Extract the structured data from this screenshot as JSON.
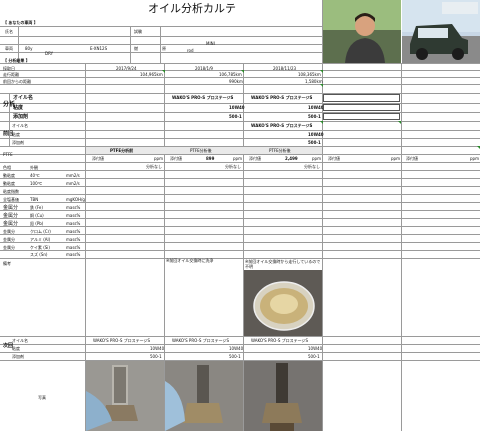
{
  "header": {
    "title": "オイル分析カルテ",
    "section_top": "【 あなたの車両 】",
    "name_label": "氏名",
    "name_value": "",
    "test_label": "試験",
    "vehicle_label": "車両",
    "vehicle_year": "80y",
    "vehicle_engine": "DRY",
    "vehicle_model": "E-XN12S",
    "vehicle_fuel_label": "燃",
    "vehicle_fuel": "原",
    "vehicle_extra": "rod",
    "vehicle_code": "MINI"
  },
  "section_results": "【 分析結果 】",
  "dates": [
    "2017/9/24",
    "2018/1/9",
    "2018/11/23"
  ],
  "rows": {
    "sample_date": "採取日",
    "mileage": "走行距離",
    "mileage_values": [
      "104,965km",
      "106,785km",
      "108,365km"
    ],
    "oil_change_distance": "前回からの距離",
    "oil_change_values": [
      "",
      "990km",
      "1,580km"
    ],
    "oil_name_label": "オイル名",
    "oil_grade_label": "粘度",
    "oil_add_label": "添加剤",
    "group_left_1": "分析",
    "group_left_2": "前回",
    "oil_names": [
      "WAKO'S PRO-S プロステージS",
      "WAKO'S PRO-S プロステージS"
    ],
    "oil_grades": [
      "10W40",
      "10W40"
    ],
    "oil_adds": [
      "500-1",
      "500-1"
    ],
    "prev_oil_names": [
      "WAKO'S PRO-S プロステージS"
    ],
    "prev_oil_grades": [
      "10W40"
    ],
    "prev_oil_adds": [
      "500-1"
    ]
  },
  "metrics": {
    "section_label": "PTFE",
    "col_heads": [
      "PTFE分析前",
      "PTFE分析後",
      "PTFE分析後"
    ],
    "sub_head_a": "添付値",
    "sub_head_b": "添付値",
    "unit": "ppm",
    "values_a": [
      "分析なし",
      "分析なし",
      "分析なし"
    ],
    "values_b": [
      "",
      "899",
      "2,499"
    ],
    "labels": [
      "色相",
      "動粘度",
      "動粘度",
      "粘度指数",
      "全塩基価",
      "金属分",
      "金属分",
      "金属分",
      "金属分",
      "金属分",
      "金属分",
      "備考"
    ],
    "sub_labels": [
      "外観",
      "40℃",
      "100℃",
      "",
      "TBN",
      "鉄 (Fe)",
      "銅 (Cu)",
      "鉛 (Pb)",
      "クロム (Cr)",
      "アルミ (Al)",
      "ケイ素 (Si)",
      "スズ (Sn)"
    ],
    "units": [
      "",
      "mm2/s",
      "mm2/s",
      "",
      "mgKOH/g",
      "mass%",
      "mass%",
      "mass%",
      "mass%",
      "mass%",
      "mass%",
      "mass%"
    ],
    "notes": [
      "",
      "※前回オイル交換時に洗浄",
      "※前回オイル交換時から走行しているので不明"
    ]
  },
  "bottom": {
    "group_left": "次回",
    "oil_name_label": "オイル名",
    "oil_grade_label": "粘度",
    "oil_add_label": "添加剤",
    "names": [
      "WAKO'S PRO-S プロステージS",
      "WAKO'S PRO-S プロステージS",
      "WAKO'S PRO-S プロステージS"
    ],
    "grades": [
      "10W40",
      "10W40",
      "10W40"
    ],
    "adds": [
      "500-1",
      "500-1",
      "500-1"
    ],
    "photo_label": "写真"
  },
  "colors": {
    "grid": "#9a9a9a",
    "header_fill": "#e9e9e9",
    "marker": "#2a8a2a"
  }
}
